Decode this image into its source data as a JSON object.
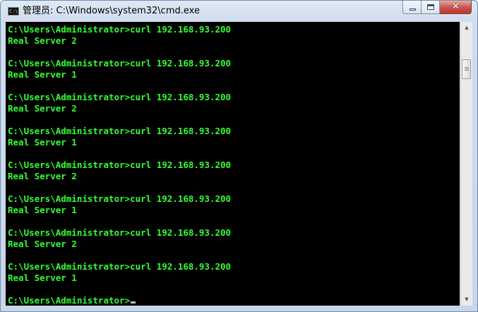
{
  "window": {
    "title": "管理员: C:\\Windows\\system32\\cmd.exe",
    "icon_text": "C:\\",
    "buttons": {
      "minimize_icon": "minimize-icon",
      "maximize_icon": "maximize-icon",
      "close_glyph": "✕"
    }
  },
  "console": {
    "lines": [
      "C:\\Users\\Administrator>curl 192.168.93.200",
      "Real Server 2",
      "",
      "C:\\Users\\Administrator>curl 192.168.93.200",
      "Real Server 1",
      "",
      "C:\\Users\\Administrator>curl 192.168.93.200",
      "Real Server 2",
      "",
      "C:\\Users\\Administrator>curl 192.168.93.200",
      "Real Server 1",
      "",
      "C:\\Users\\Administrator>curl 192.168.93.200",
      "Real Server 2",
      "",
      "C:\\Users\\Administrator>curl 192.168.93.200",
      "Real Server 1",
      "",
      "C:\\Users\\Administrator>curl 192.168.93.200",
      "Real Server 2",
      "",
      "C:\\Users\\Administrator>curl 192.168.93.200",
      "Real Server 1",
      ""
    ],
    "prompt": "C:\\Users\\Administrator>",
    "text_color": "#33ff33",
    "background_color": "#000000"
  },
  "scrollbar": {
    "up_arrow": "▲",
    "down_arrow": "▼"
  }
}
